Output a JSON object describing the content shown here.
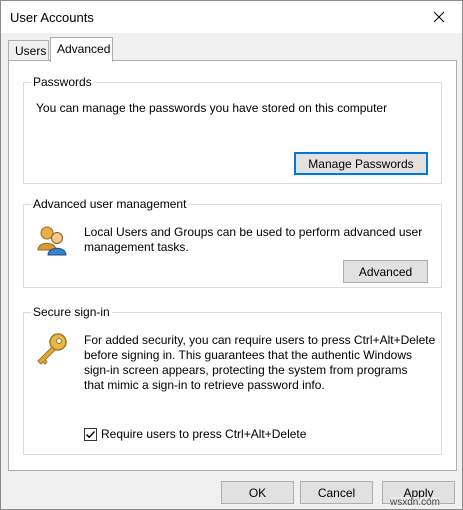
{
  "window": {
    "title": "User Accounts",
    "close_icon": "close-icon"
  },
  "tabs": [
    {
      "label": "Users",
      "selected": false
    },
    {
      "label": "Advanced",
      "selected": true
    }
  ],
  "passwords": {
    "group_title": "Passwords",
    "description": "You can manage the passwords you have stored on this computer",
    "button": "Manage Passwords"
  },
  "user_management": {
    "group_title": "Advanced user management",
    "description_line1": "Local Users and Groups can be used to perform advanced user",
    "description_line2": "management tasks.",
    "button": "Advanced",
    "icon": "users-group-icon"
  },
  "secure_signin": {
    "group_title": "Secure sign-in",
    "line1": "For added security, you can require users to press Ctrl+Alt+Delete",
    "line2": "before signing in. This guarantees that the authentic Windows",
    "line3": "sign-in screen appears, protecting the system from programs",
    "line4": "that mimic a sign-in to retrieve password info.",
    "checkbox_label": "Require users to press Ctrl+Alt+Delete",
    "checkbox_checked": true,
    "icon": "key-icon"
  },
  "footer": {
    "ok": "OK",
    "cancel": "Cancel",
    "apply": "Apply"
  },
  "watermark": "wsxdn.com"
}
